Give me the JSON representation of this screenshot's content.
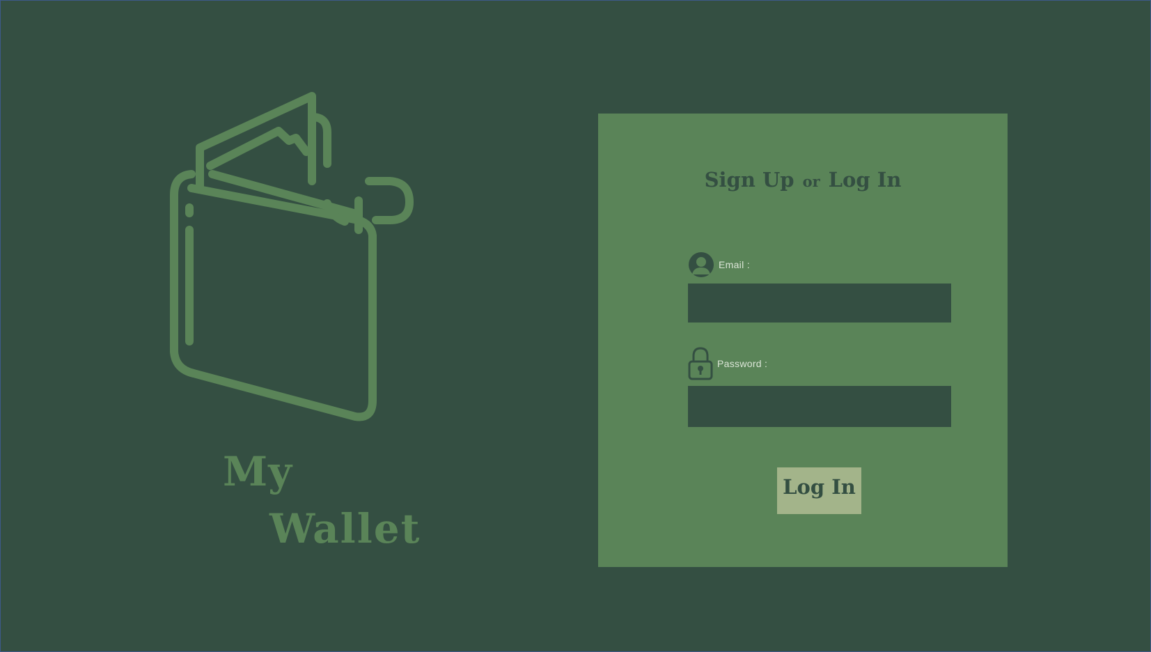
{
  "brand": {
    "line1": "My",
    "line2": "Wallet",
    "color": "#5a8458"
  },
  "form": {
    "title_sign_up": "Sign Up",
    "title_or": "or",
    "title_log_in": "Log In",
    "email_label": "Email :",
    "email_value": "",
    "password_label": "Password :",
    "password_value": "",
    "submit_label": "Log In"
  },
  "icons": {
    "logo": "wallet-icon",
    "email": "user-icon",
    "password": "lock-icon"
  },
  "colors": {
    "background": "#344f42",
    "panel": "#5a8458",
    "button": "#a3b48a",
    "input": "#344f42"
  }
}
